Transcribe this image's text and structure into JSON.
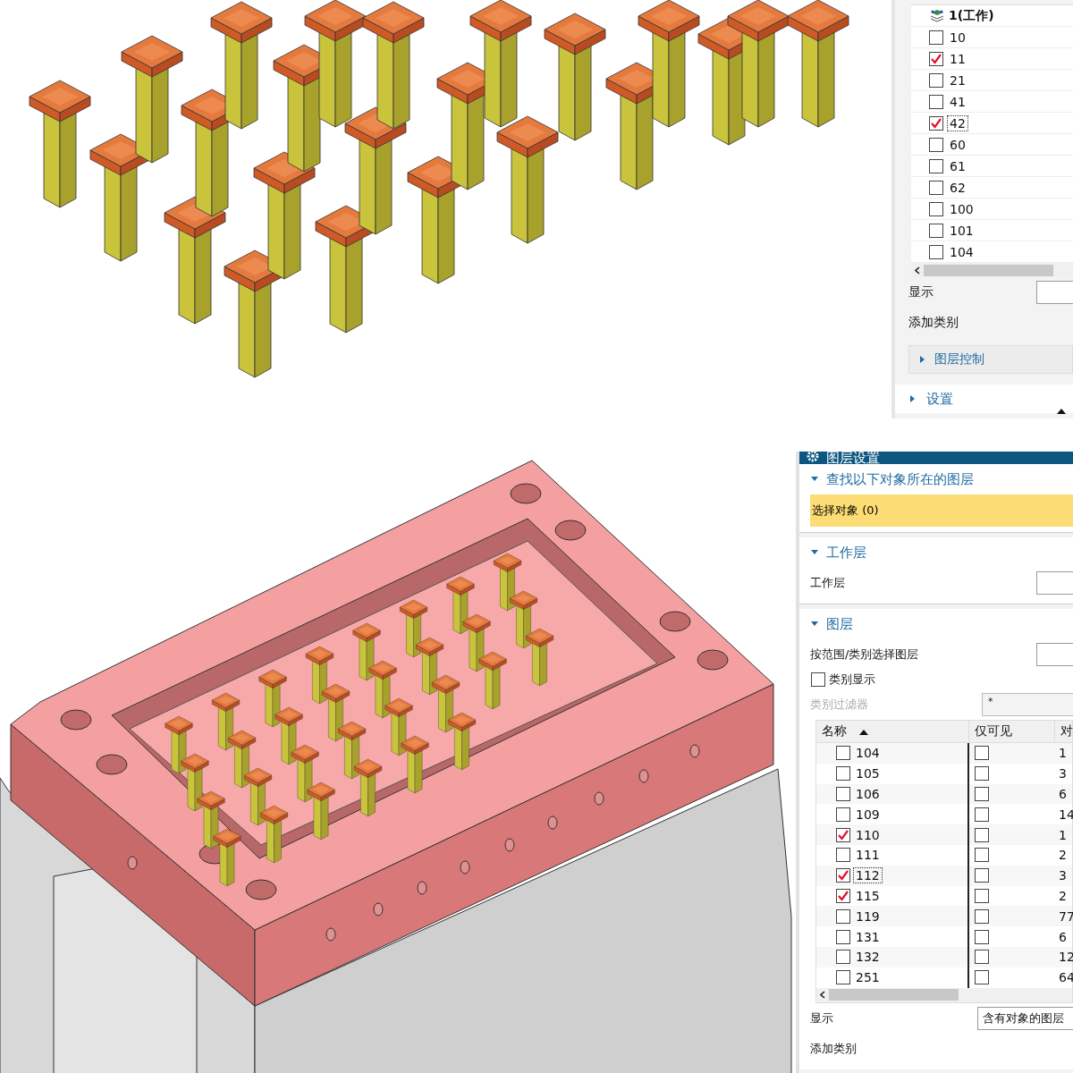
{
  "layer_panel_top": {
    "work_layer": {
      "name": "1(工作)"
    },
    "layers": [
      {
        "name": "10",
        "checked": false,
        "selected": false
      },
      {
        "name": "11",
        "checked": true,
        "selected": false
      },
      {
        "name": "21",
        "checked": false,
        "selected": false
      },
      {
        "name": "41",
        "checked": false,
        "selected": false
      },
      {
        "name": "42",
        "checked": true,
        "selected": true
      },
      {
        "name": "60",
        "checked": false,
        "selected": false
      },
      {
        "name": "61",
        "checked": false,
        "selected": false
      },
      {
        "name": "62",
        "checked": false,
        "selected": false
      },
      {
        "name": "100",
        "checked": false,
        "selected": false
      },
      {
        "name": "101",
        "checked": false,
        "selected": false
      },
      {
        "name": "104",
        "checked": false,
        "selected": false
      }
    ],
    "display_label": "显示",
    "add_category_label": "添加类别",
    "sections": [
      {
        "title": "图层控制",
        "expanded": false,
        "kind": "sub"
      },
      {
        "title": "设置",
        "expanded": false,
        "kind": "main"
      }
    ]
  },
  "layer_settings": {
    "title": "图层设置",
    "find_section": {
      "title": "查找以下对象所在的图层",
      "expanded": true,
      "select_button": "选择对象 (0)"
    },
    "work_section": {
      "title": "工作层",
      "expanded": true,
      "field_label": "工作层"
    },
    "layers_section": {
      "title": "图层",
      "expanded": true,
      "range_label": "按范围/类别选择图层",
      "category_display": {
        "label": "类别显示",
        "checked": false
      },
      "category_filter": {
        "label": "类别过滤器",
        "value": "*",
        "disabled": true
      },
      "table": {
        "columns": [
          {
            "label": "名称",
            "sorted": true
          },
          {
            "label": "仅可见",
            "sorted": false
          },
          {
            "label": "对",
            "sorted": false
          }
        ],
        "rows": [
          {
            "name": "104",
            "checked": false,
            "visible_only": false,
            "count": "1",
            "selected": false
          },
          {
            "name": "105",
            "checked": false,
            "visible_only": false,
            "count": "3",
            "selected": false
          },
          {
            "name": "106",
            "checked": false,
            "visible_only": false,
            "count": "6",
            "selected": false
          },
          {
            "name": "109",
            "checked": false,
            "visible_only": false,
            "count": "14",
            "selected": false
          },
          {
            "name": "110",
            "checked": true,
            "visible_only": false,
            "count": "1",
            "selected": false
          },
          {
            "name": "111",
            "checked": false,
            "visible_only": false,
            "count": "2",
            "selected": false
          },
          {
            "name": "112",
            "checked": true,
            "visible_only": false,
            "count": "3",
            "selected": true
          },
          {
            "name": "115",
            "checked": true,
            "visible_only": false,
            "count": "2",
            "selected": false
          },
          {
            "name": "119",
            "checked": false,
            "visible_only": false,
            "count": "77",
            "selected": false
          },
          {
            "name": "131",
            "checked": false,
            "visible_only": false,
            "count": "6",
            "selected": false
          },
          {
            "name": "132",
            "checked": false,
            "visible_only": false,
            "count": "12",
            "selected": false
          },
          {
            "name": "251",
            "checked": false,
            "visible_only": false,
            "count": "64",
            "selected": false
          }
        ]
      },
      "display_label": "显示",
      "display_value": "含有对象的图层",
      "add_category_label": "添加类别"
    }
  }
}
